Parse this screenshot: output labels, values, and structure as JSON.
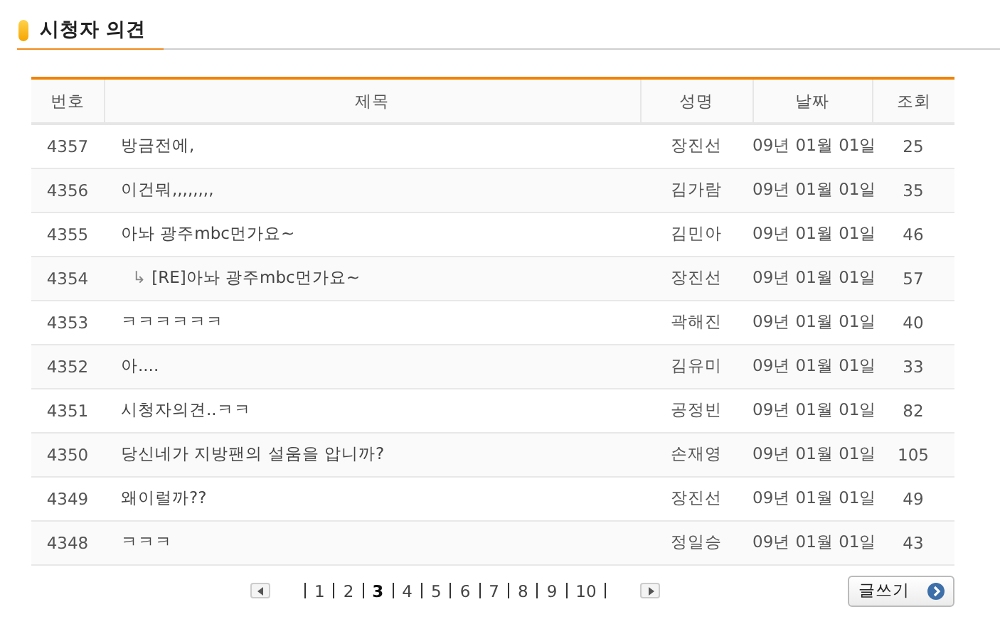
{
  "section_title": "시청자 의견",
  "table": {
    "columns": [
      "번호",
      "제목",
      "성명",
      "날짜",
      "조회"
    ],
    "rows": [
      {
        "number": "4357",
        "kind": "post",
        "title": "방금전에,",
        "author": "장진선",
        "date": "09년 01월 01일",
        "views": "25"
      },
      {
        "number": "4356",
        "kind": "post",
        "title": "이건뭐,,,,,,,,",
        "author": "김가람",
        "date": "09년 01월 01일",
        "views": "35"
      },
      {
        "number": "4355",
        "kind": "post",
        "title": "아놔 광주mbc먼가요~",
        "author": "김민아",
        "date": "09년 01월 01일",
        "views": "46"
      },
      {
        "number": "4354",
        "kind": "reply",
        "marker": "↳",
        "title": "[RE]아놔 광주mbc먼가요~",
        "author": "장진선",
        "date": "09년 01월 01일",
        "views": "57"
      },
      {
        "number": "4353",
        "kind": "post",
        "title": "ㅋㅋㅋㅋㅋㅋ",
        "author": "곽해진",
        "date": "09년 01월 01일",
        "views": "40"
      },
      {
        "number": "4352",
        "kind": "post",
        "title": "아....",
        "author": "김유미",
        "date": "09년 01월 01일",
        "views": "33"
      },
      {
        "number": "4351",
        "kind": "post",
        "title": "시청자의견..ㅋㅋ",
        "author": "공정빈",
        "date": "09년 01월 01일",
        "views": "82"
      },
      {
        "number": "4350",
        "kind": "post",
        "title": "당신네가 지방팬의 설움을 압니까?",
        "author": "손재영",
        "date": "09년 01월 01일",
        "views": "105"
      },
      {
        "number": "4349",
        "kind": "post",
        "title": "왜이럴까??",
        "author": "장진선",
        "date": "09년 01월 01일",
        "views": "49"
      },
      {
        "number": "4348",
        "kind": "post",
        "title": "ㅋㅋㅋ",
        "author": "정일승",
        "date": "09년 01월 01일",
        "views": "43"
      }
    ]
  },
  "pagination": {
    "pages": [
      {
        "label": "1",
        "selected": false
      },
      {
        "label": "2",
        "selected": false
      },
      {
        "label": "3",
        "selected": true
      },
      {
        "label": "4",
        "selected": false
      },
      {
        "label": "5",
        "selected": false
      },
      {
        "label": "6",
        "selected": false
      },
      {
        "label": "7",
        "selected": false
      },
      {
        "label": "8",
        "selected": false
      },
      {
        "label": "9",
        "selected": false
      },
      {
        "label": "10",
        "selected": false
      }
    ]
  },
  "write_button": "글쓰기"
}
